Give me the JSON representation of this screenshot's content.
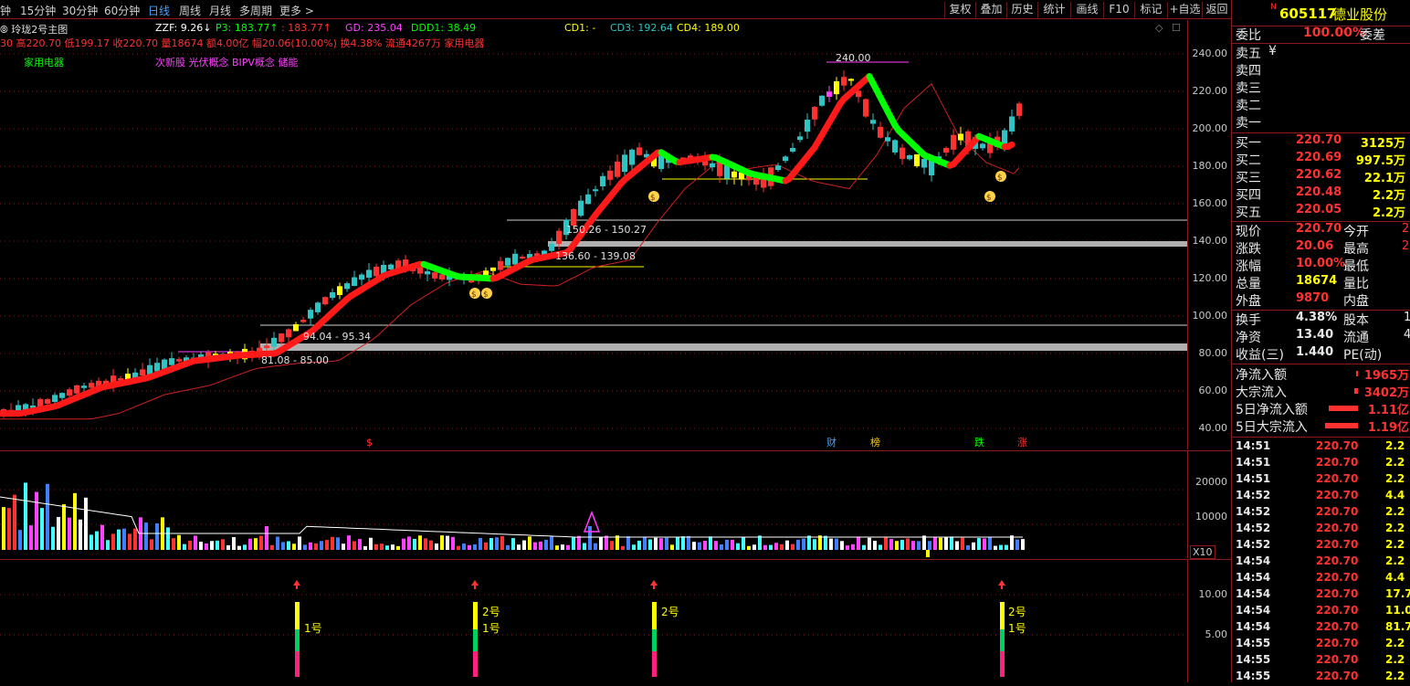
{
  "toolbar": {
    "periods": [
      {
        "label": "钟"
      },
      {
        "label": "15分钟"
      },
      {
        "label": "30分钟"
      },
      {
        "label": "60分钟"
      },
      {
        "label": "日线"
      },
      {
        "label": "周线"
      },
      {
        "label": "月线"
      },
      {
        "label": "多周期"
      },
      {
        "label": "更多 >"
      }
    ],
    "active_period": "日线",
    "buttons": [
      "复权",
      "叠加",
      "历史",
      "统计",
      "画线",
      "F10",
      "标记",
      "+自选",
      "返回"
    ]
  },
  "chart_header": {
    "title": "玲珑2号主图",
    "zzf": "ZZF: 9.26↓",
    "p3": "P3: 183.77↑",
    "p3b": ": 183.77↑",
    "gd": "GD: 235.04",
    "ddd1": "DDD1: 38.49",
    "cd1": "CD1: -",
    "cd3": "CD3: 192.64",
    "cd4": "CD4: 189.00",
    "info_line": "30 高220.70 低199.17 收220.70 量18674 额4.00亿 幅20.06(10.00%) 换4.38% 流通4267万 家用电器",
    "sector": "家用电器",
    "concepts": "次新股 光伏概念 BIPV概念 储能"
  },
  "price_axis": [
    "240.00",
    "220.00",
    "200.00",
    "180.00",
    "160.00",
    "140.00",
    "120.00",
    "100.00",
    "80.00",
    "60.00",
    "40.00"
  ],
  "volume_axis": [
    "20000",
    "10000"
  ],
  "volume_unit": "X10",
  "signal_axis": [
    "10.00",
    "5.00"
  ],
  "annotations": {
    "high_label": "240.00",
    "zones": [
      "150.26 - 150.27",
      "136.60 - 139.08",
      "94.04 - 95.34",
      "81.08 - 85.00"
    ],
    "events": [
      "$",
      "财",
      "榜",
      "跌",
      "涨"
    ]
  },
  "signals": [
    {
      "labels": [
        "1号"
      ]
    },
    {
      "labels": [
        "2号",
        "1号"
      ]
    },
    {
      "labels": [
        "2号"
      ]
    },
    {
      "labels": [
        "2号",
        "1号"
      ]
    }
  ],
  "stock": {
    "code": "605117",
    "name": "德业股份",
    "badge": "N"
  },
  "order_book": {
    "weibi_label": "委比",
    "weibi": "100.00%",
    "weicha_label": "委差",
    "sell": [
      {
        "label": "卖五",
        "price": "¥",
        "vol": ""
      },
      {
        "label": "卖四",
        "price": "",
        "vol": ""
      },
      {
        "label": "卖三",
        "price": "",
        "vol": ""
      },
      {
        "label": "卖二",
        "price": "",
        "vol": ""
      },
      {
        "label": "卖一",
        "price": "",
        "vol": ""
      }
    ],
    "buy": [
      {
        "label": "买一",
        "price": "220.70",
        "vol": "3125万"
      },
      {
        "label": "买二",
        "price": "220.69",
        "vol": "997.5万"
      },
      {
        "label": "买三",
        "price": "220.62",
        "vol": "22.1万"
      },
      {
        "label": "买四",
        "price": "220.48",
        "vol": "2.2万"
      },
      {
        "label": "买五",
        "price": "220.05",
        "vol": "2.2万"
      }
    ]
  },
  "quote": [
    {
      "l1": "现价",
      "v1": "220.70",
      "l2": "今开",
      "v2": "2"
    },
    {
      "l1": "涨跌",
      "v1": "20.06",
      "l2": "最高",
      "v2": "2"
    },
    {
      "l1": "涨幅",
      "v1": "10.00%",
      "l2": "最低",
      "v2": ""
    },
    {
      "l1": "总量",
      "v1": "18674",
      "l2": "量比",
      "v2": ""
    },
    {
      "l1": "外盘",
      "v1": "9870",
      "l2": "内盘",
      "v2": ""
    }
  ],
  "fundamentals": [
    {
      "l1": "换手",
      "v1": "4.38%",
      "l2": "股本",
      "v2": "1"
    },
    {
      "l1": "净资",
      "v1": "13.40",
      "l2": "流通",
      "v2": "4"
    },
    {
      "l1": "收益(三)",
      "v1": "1.440",
      "l2": "PE(动)",
      "v2": ""
    }
  ],
  "flows": [
    {
      "label": "净流入额",
      "value": "1965万",
      "bar": 0.06
    },
    {
      "label": "大宗流入",
      "value": "3402万",
      "bar": 0.1
    },
    {
      "label": "5日净流入额",
      "value": "1.11亿",
      "bar": 0.8
    },
    {
      "label": "5日大宗流入",
      "value": "1.19亿",
      "bar": 0.9
    }
  ],
  "ticks": [
    {
      "time": "14:51",
      "price": "220.70",
      "vol": "2.2"
    },
    {
      "time": "14:51",
      "price": "220.70",
      "vol": "2.2"
    },
    {
      "time": "14:51",
      "price": "220.70",
      "vol": "2.2"
    },
    {
      "time": "14:52",
      "price": "220.70",
      "vol": "4.4"
    },
    {
      "time": "14:52",
      "price": "220.70",
      "vol": "2.2"
    },
    {
      "time": "14:52",
      "price": "220.70",
      "vol": "2.2"
    },
    {
      "time": "14:52",
      "price": "220.70",
      "vol": "2.2"
    },
    {
      "time": "14:54",
      "price": "220.70",
      "vol": "2.2"
    },
    {
      "time": "14:54",
      "price": "220.70",
      "vol": "4.4"
    },
    {
      "time": "14:54",
      "price": "220.70",
      "vol": "17.7"
    },
    {
      "time": "14:54",
      "price": "220.70",
      "vol": "11.0"
    },
    {
      "time": "14:54",
      "price": "220.70",
      "vol": "81.7"
    },
    {
      "time": "14:55",
      "price": "220.70",
      "vol": "2.2"
    },
    {
      "time": "14:55",
      "price": "220.70",
      "vol": "2.2"
    },
    {
      "time": "14:55",
      "price": "220.70",
      "vol": "2.2"
    }
  ],
  "colors": {
    "up": "#ff3232",
    "down": "#2ec4c4",
    "yellow": "#ffff00",
    "green": "#00ff00",
    "magenta": "#ff40ff",
    "grid": "#8b1a1a"
  }
}
